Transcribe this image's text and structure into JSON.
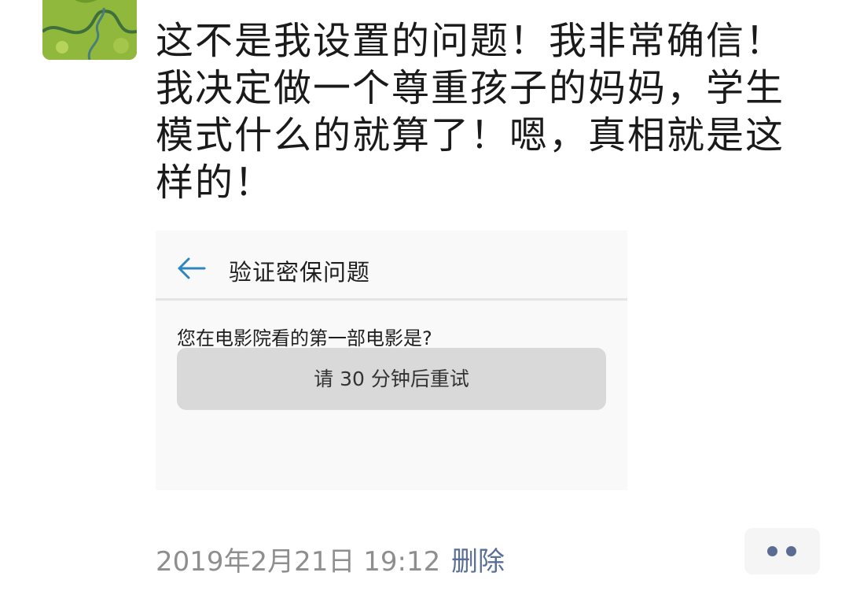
{
  "post": {
    "text": "这不是我设置的问题！我非常确信！\n我决定做一个尊重孩子的妈妈，学生\n模式什么的就算了！嗯，真相就是这\n样的！"
  },
  "screenshot": {
    "back_icon": "arrow-left-icon",
    "title": "验证密保问题",
    "question": "您在电影院看的第一部电影是?",
    "retry_message": "请 30 分钟后重试"
  },
  "meta": {
    "timestamp": "2019年2月21日 19:12",
    "delete_label": "删除",
    "more_icon": "two-dots-icon"
  },
  "colors": {
    "text": "#1a1a1a",
    "meta_gray": "#8e8e8e",
    "link_blue": "#5a6f97",
    "back_arrow": "#2e86c1",
    "retry_box": "#d9d9d9"
  }
}
